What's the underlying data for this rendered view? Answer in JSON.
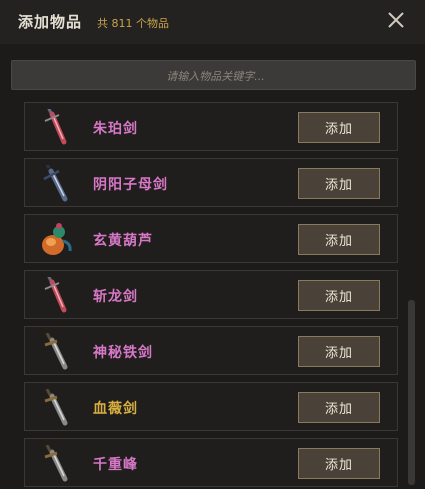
{
  "header": {
    "title": "添加物品",
    "count": "共 811 个物品"
  },
  "search": {
    "placeholder": "请输入物品关键字..."
  },
  "items": [
    {
      "name": "朱珀剑",
      "icon": "red-sword-icon",
      "quality_color": "#d778c6"
    },
    {
      "name": "阴阳子母剑",
      "icon": "blue-sword-icon",
      "quality_color": "#d778c6"
    },
    {
      "name": "玄黄葫芦",
      "icon": "gourd-icon",
      "quality_color": "#d778c6"
    },
    {
      "name": "斩龙剑",
      "icon": "red-sword-icon",
      "quality_color": "#d778c6"
    },
    {
      "name": "神秘铁剑",
      "icon": "iron-sword-icon",
      "quality_color": "#d778c6"
    },
    {
      "name": "血薇剑",
      "icon": "iron-sword-icon",
      "quality_color": "#d9b040"
    },
    {
      "name": "千重峰",
      "icon": "iron-sword-icon",
      "quality_color": "#d778c6"
    }
  ],
  "add_label": "添加"
}
